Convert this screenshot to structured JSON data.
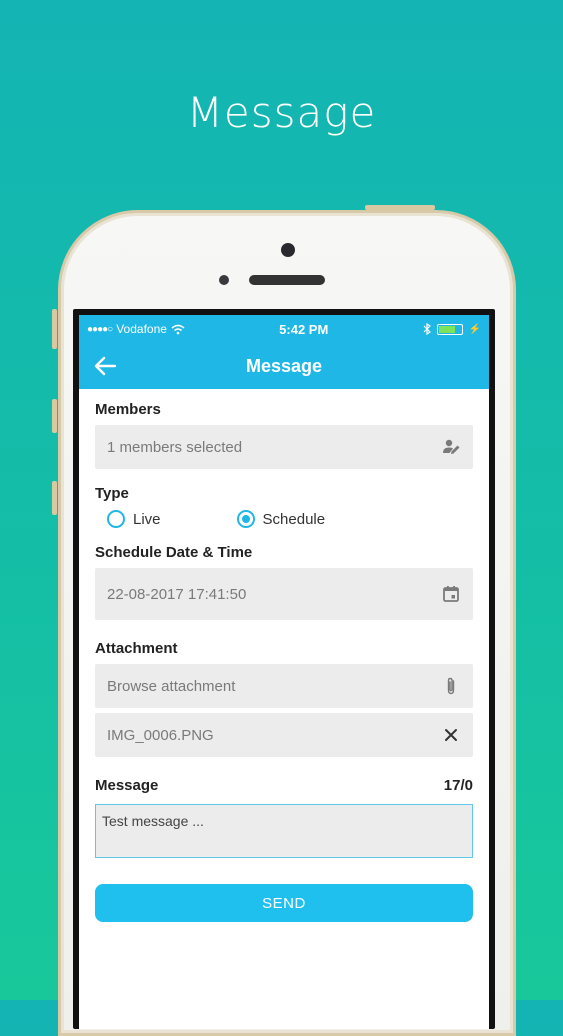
{
  "promo": {
    "title": "Message"
  },
  "status_bar": {
    "carrier": "Vodafone",
    "time": "5:42 PM"
  },
  "app_bar": {
    "title": "Message"
  },
  "members": {
    "label": "Members",
    "value": "1 members selected"
  },
  "type": {
    "label": "Type",
    "options": [
      "Live",
      "Schedule"
    ],
    "selected": "Schedule"
  },
  "schedule": {
    "label": "Schedule Date & Time",
    "value": "22-08-2017 17:41:50"
  },
  "attachment": {
    "label": "Attachment",
    "browse_placeholder": "Browse attachment",
    "file_name": "IMG_0006.PNG"
  },
  "message": {
    "label": "Message",
    "counter": "17/0",
    "value": "Test message ..."
  },
  "send": {
    "label": "SEND"
  },
  "colors": {
    "accent": "#1fb8e6",
    "background_top": "#14b4b4",
    "background_bottom": "#18c89a"
  }
}
